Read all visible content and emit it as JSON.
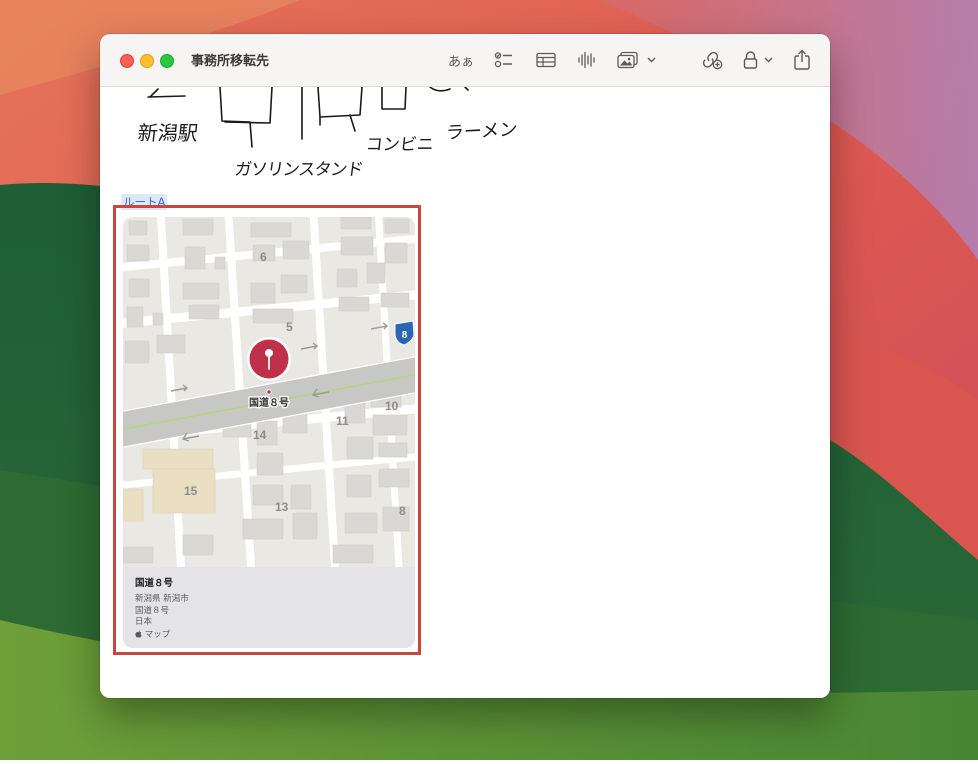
{
  "window": {
    "title": "事務所移転先",
    "toolbar": {
      "format_label": "あぁ",
      "checklist_icon": "checklist-icon",
      "table_icon": "table-icon",
      "audio_icon": "waveform-icon",
      "media_icon": "photo-icon",
      "collab_icon": "link-collab-icon",
      "lock_icon": "lock-icon",
      "share_icon": "share-icon"
    }
  },
  "note": {
    "sketch_labels": [
      "新潟駅",
      "ガソリンスタンド",
      "コンビニ",
      "ラーメン"
    ],
    "route_label": "ルートA"
  },
  "map_card": {
    "pin_label": "国道８号",
    "route_shield": "8",
    "block_numbers": [
      "6",
      "5",
      "11",
      "10",
      "14",
      "15",
      "13",
      "8"
    ],
    "place_name": "国道８号",
    "address_lines": [
      "新潟県 新潟市",
      "国道８号",
      "日本"
    ],
    "source": "マップ"
  },
  "colors": {
    "highlight_border": "#c8483f",
    "pin": "#c0304a",
    "road": "#c7c8c6",
    "background_green": "#1f5a34",
    "background_red": "#d8524d"
  }
}
